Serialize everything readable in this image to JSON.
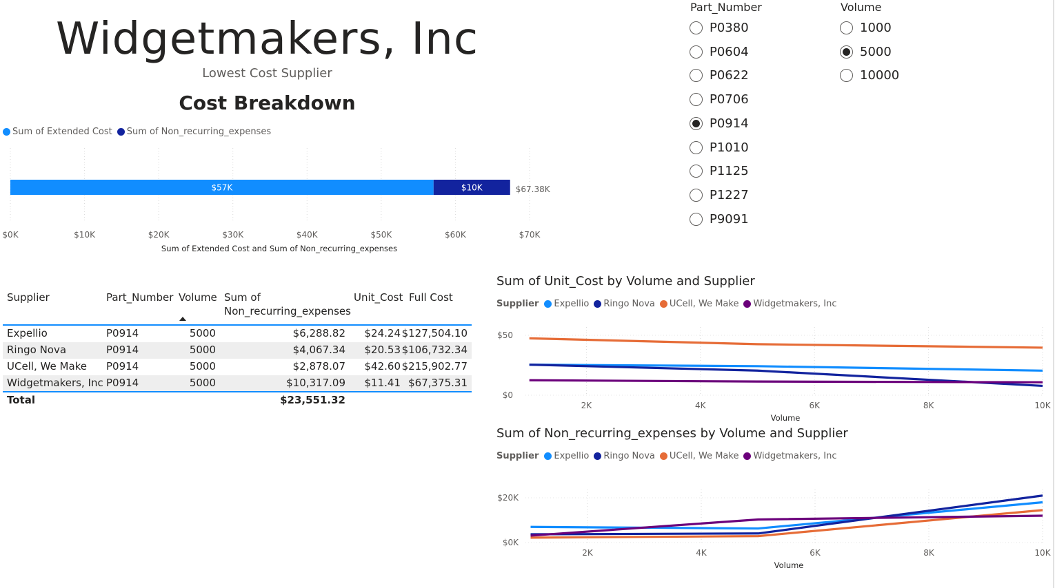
{
  "header": {
    "title": "Widgetmakers, Inc",
    "subtitle": "Lowest Cost Supplier",
    "section_title": "Cost Breakdown"
  },
  "breakdown_legend": [
    "Sum of Extended Cost",
    "Sum of Non_recurring_expenses"
  ],
  "colors": {
    "extended": "#118dff",
    "nonrec": "#12239e",
    "expellio": "#118dff",
    "ringo": "#12239e",
    "ucell": "#e66c37",
    "widget": "#6b007b"
  },
  "slicers": {
    "part_number": {
      "label": "Part_Number",
      "options": [
        "P0380",
        "P0604",
        "P0622",
        "P0706",
        "P0914",
        "P1010",
        "P1125",
        "P1227",
        "P9091"
      ],
      "selected": "P0914"
    },
    "volume": {
      "label": "Volume",
      "options": [
        "1000",
        "5000",
        "10000"
      ],
      "selected": "5000"
    }
  },
  "table": {
    "headers": [
      "Supplier",
      "Part_Number",
      "Volume",
      "Sum of Non_recurring_expenses",
      "Unit_Cost",
      "Full Cost"
    ],
    "header_sum_line1": "Sum of",
    "header_sum_line2": "Non_recurring_expenses",
    "rows": [
      [
        "Expellio",
        "P0914",
        "5000",
        "$6,288.82",
        "$24.24",
        "$127,504.10"
      ],
      [
        "Ringo Nova",
        "P0914",
        "5000",
        "$4,067.34",
        "$20.53",
        "$106,732.34"
      ],
      [
        "UCell, We Make",
        "P0914",
        "5000",
        "$2,878.07",
        "$42.60",
        "$215,902.77"
      ],
      [
        "Widgetmakers, Inc",
        "P0914",
        "5000",
        "$10,317.09",
        "$11.41",
        "$67,375.31"
      ]
    ],
    "total_label": "Total",
    "total_value": "$23,551.32"
  },
  "chart_data": [
    {
      "type": "bar",
      "orientation": "horizontal-stacked",
      "series": [
        {
          "name": "Sum of Extended Cost",
          "values": [
            57058
          ]
        },
        {
          "name": "Sum of Non_recurring_expenses",
          "values": [
            10317
          ]
        }
      ],
      "data_labels": [
        "$57K",
        "$10K"
      ],
      "total_label": "$67.38K",
      "xlim": [
        0,
        70000
      ],
      "xticks": [
        "$0K",
        "$10K",
        "$20K",
        "$30K",
        "$40K",
        "$50K",
        "$60K",
        "$70K"
      ],
      "xlabel": "Sum of Extended Cost and Sum of Non_recurring_expenses",
      "legend": "top-left",
      "grid": true
    },
    {
      "type": "line",
      "title": "Sum of Unit_Cost by Volume and Supplier",
      "legend_title": "Supplier",
      "x": [
        1000,
        5000,
        10000
      ],
      "series": [
        {
          "name": "Expellio",
          "values": [
            25.5,
            24.24,
            20.5
          ]
        },
        {
          "name": "Ringo Nova",
          "values": [
            25.5,
            20.53,
            7.8
          ]
        },
        {
          "name": "UCell, We Make",
          "values": [
            47.5,
            42.6,
            39.7
          ]
        },
        {
          "name": "Widgetmakers, Inc",
          "values": [
            12.5,
            11.41,
            10.8
          ]
        }
      ],
      "xlabel": "Volume",
      "xticks": [
        "2K",
        "4K",
        "6K",
        "8K",
        "10K"
      ],
      "yticks": [
        "$0",
        "$50"
      ],
      "ylim": [
        0,
        50
      ],
      "xlim": [
        0,
        10000
      ]
    },
    {
      "type": "line",
      "title": "Sum of Non_recurring_expenses by Volume and Supplier",
      "legend_title": "Supplier",
      "x": [
        1000,
        5000,
        10000
      ],
      "series": [
        {
          "name": "Expellio",
          "values": [
            7000,
            6288.82,
            18000
          ]
        },
        {
          "name": "Ringo Nova",
          "values": [
            3700,
            4067.34,
            21000
          ]
        },
        {
          "name": "UCell, We Make",
          "values": [
            2200,
            2878.07,
            14500
          ]
        },
        {
          "name": "Widgetmakers, Inc",
          "values": [
            3100,
            10317.09,
            12000
          ]
        }
      ],
      "xlabel": "Volume",
      "xticks": [
        "2K",
        "4K",
        "6K",
        "8K",
        "10K"
      ],
      "yticks": [
        "$0K",
        "$20K"
      ],
      "ylim": [
        0,
        20000
      ],
      "xlim": [
        0,
        10000
      ]
    }
  ]
}
